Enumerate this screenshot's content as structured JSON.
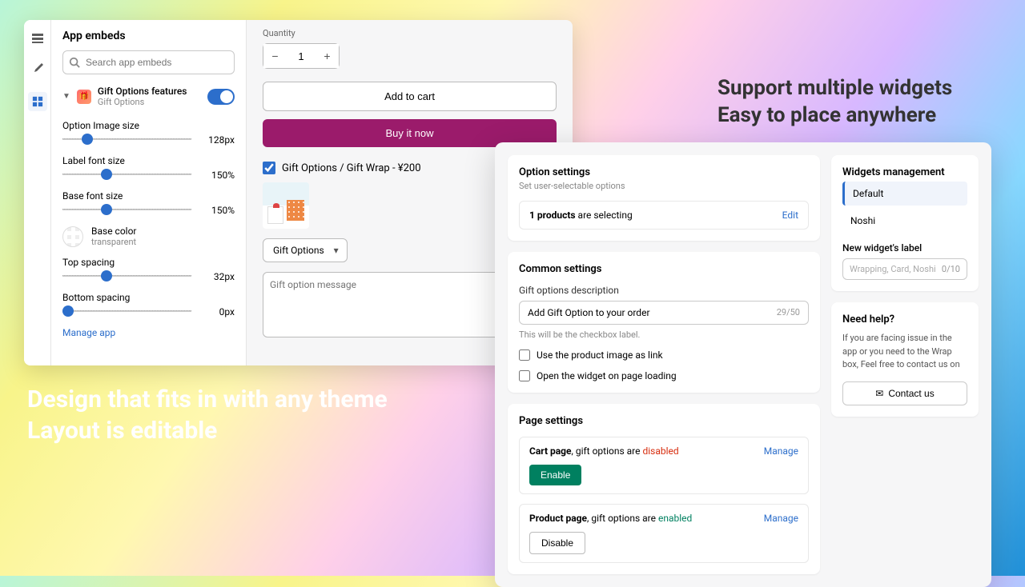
{
  "headline_right": {
    "line1": "Support multiple widgets",
    "line2": "Easy to place anywhere"
  },
  "headline_left": {
    "line1": "Design that fits in with any theme",
    "line2": "Layout is editable"
  },
  "sidebar": {
    "title": "App embeds",
    "search_placeholder": "Search app embeds",
    "embed": {
      "name": "Gift Options features",
      "app": "Gift Options"
    },
    "sliders": {
      "image_size": {
        "label": "Option Image size",
        "value": "128px",
        "pct": 15
      },
      "label_font": {
        "label": "Label font size",
        "value": "150%",
        "pct": 30
      },
      "base_font": {
        "label": "Base font size",
        "value": "150%",
        "pct": 30
      },
      "top_spacing": {
        "label": "Top spacing",
        "value": "32px",
        "pct": 30
      },
      "bottom_spacing": {
        "label": "Bottom spacing",
        "value": "0px",
        "pct": 0
      }
    },
    "color": {
      "label": "Base color",
      "value": "transparent"
    },
    "manage": "Manage app"
  },
  "preview": {
    "qty_label": "Quantity",
    "qty_value": "1",
    "add_to_cart": "Add to cart",
    "buy_now": "Buy it now",
    "gift_check": "Gift Options / Gift Wrap - ¥200",
    "select": "Gift Options",
    "msg_placeholder": "Gift option message"
  },
  "settings": {
    "option": {
      "title": "Option settings",
      "sub": "Set user-selectable options",
      "selecting_count": "1 products",
      "selecting_suffix": " are selecting",
      "edit": "Edit"
    },
    "common": {
      "title": "Common settings",
      "desc_label": "Gift options description",
      "desc_value": "Add Gift Option to your order",
      "desc_count": "29/50",
      "desc_hint": "This will be the checkbox label.",
      "chk1": "Use the product image as link",
      "chk2": "Open the widget on page loading"
    },
    "page": {
      "title": "Page settings",
      "cart_label": "Cart page",
      "options_are": ", gift options are ",
      "disabled": "disabled",
      "enabled": "enabled",
      "product_label": "Product page",
      "enable": "Enable",
      "disable": "Disable",
      "manage": "Manage"
    },
    "widgets": {
      "title": "Widgets management",
      "items": [
        "Default",
        "Noshi"
      ],
      "new_label": "New widget's label",
      "new_placeholder": "Wrapping, Card, Noshi",
      "new_count": "0/10"
    },
    "help": {
      "title": "Need help?",
      "text": "If you are facing issue in the app or you need to the Wrap box, Feel free to contact us on",
      "contact": "Contact us"
    }
  }
}
